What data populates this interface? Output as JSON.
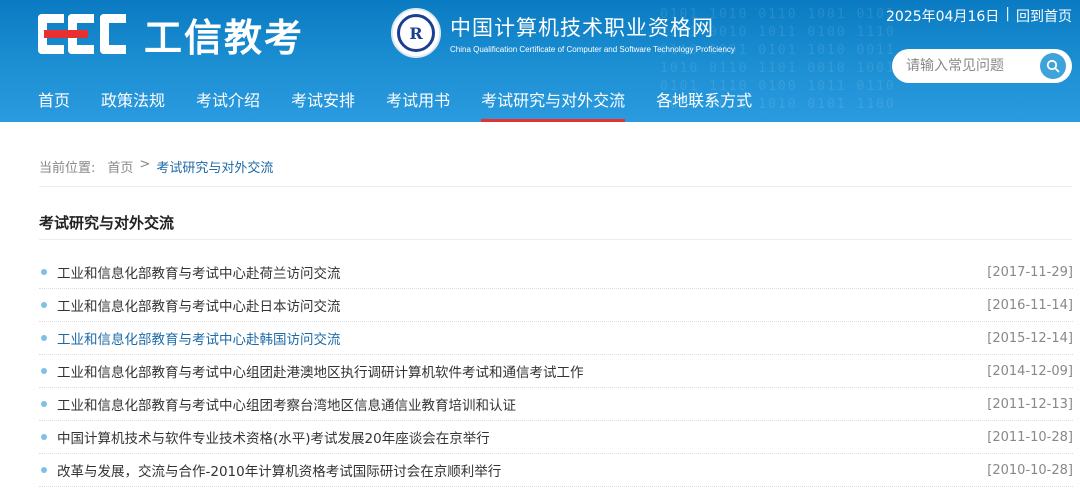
{
  "header": {
    "logo_text": "工信教考",
    "logo_mark": "CEC",
    "seal_icon": "certificate-seal-icon",
    "site_name_cn": "中国计算机技术职业资格网",
    "site_name_en": "China Qualification Certificate of Computer and Software Technology Proficiency",
    "date": "2025年04月16日",
    "separator": "|",
    "home_link": "回到首页",
    "search": {
      "placeholder": "请输入常见问题",
      "icon": "search-icon"
    },
    "brand_colors": {
      "header_blue": "#0a7bc2",
      "accent_red": "#e8312f"
    }
  },
  "nav": {
    "items": [
      {
        "label": "首页"
      },
      {
        "label": "政策法规"
      },
      {
        "label": "考试介绍"
      },
      {
        "label": "考试安排"
      },
      {
        "label": "考试用书"
      },
      {
        "label": "考试研究与对外交流",
        "active": true
      },
      {
        "label": "各地联系方式"
      }
    ]
  },
  "breadcrumb": {
    "prefix": "当前位置:",
    "home": "首页",
    "arrow": ">",
    "current": "考试研究与对外交流"
  },
  "section_title": "考试研究与对外交流",
  "articles": [
    {
      "title": "工业和信息化部教育与考试中心赴荷兰访问交流",
      "date": "[2017-11-29]"
    },
    {
      "title": "工业和信息化部教育与考试中心赴日本访问交流",
      "date": "[2016-11-14]"
    },
    {
      "title": "工业和信息化部教育与考试中心赴韩国访问交流",
      "date": "[2015-12-14]",
      "highlighted": true
    },
    {
      "title": "工业和信息化部教育与考试中心组团赴港澳地区执行调研计算机软件考试和通信考试工作",
      "date": "[2014-12-09]"
    },
    {
      "title": "工业和信息化部教育与考试中心组团考察台湾地区信息通信业教育培训和认证",
      "date": "[2011-12-13]"
    },
    {
      "title": "中国计算机技术与软件专业技术资格(水平)考试发展20年座谈会在京举行",
      "date": "[2011-10-28]"
    },
    {
      "title": "改革与发展，交流与合作-2010年计算机资格考试国际研讨会在京顺利举行",
      "date": "[2010-10-28]"
    }
  ]
}
